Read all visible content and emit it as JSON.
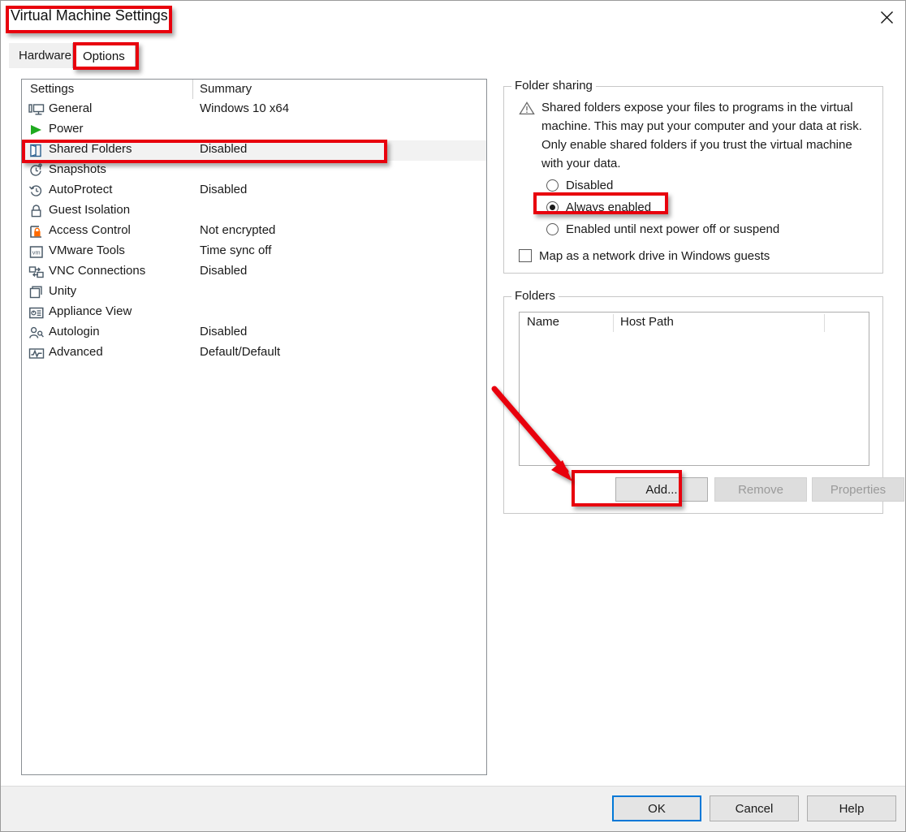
{
  "window": {
    "title": "Virtual Machine Settings",
    "close_icon": "close-icon"
  },
  "tabs": [
    {
      "label": "Hardware",
      "active": false
    },
    {
      "label": "Options",
      "active": true
    }
  ],
  "settings_list": {
    "columns": [
      "Settings",
      "Summary"
    ],
    "rows": [
      {
        "icon": "monitor-icon",
        "name": "General",
        "summary": "Windows 10 x64",
        "selected": false
      },
      {
        "icon": "play-icon",
        "name": "Power",
        "summary": "",
        "selected": false
      },
      {
        "icon": "shared-folder-icon",
        "name": "Shared Folders",
        "summary": "Disabled",
        "selected": true
      },
      {
        "icon": "snapshot-clock-icon",
        "name": "Snapshots",
        "summary": "",
        "selected": false
      },
      {
        "icon": "autoprotect-icon",
        "name": "AutoProtect",
        "summary": "Disabled",
        "selected": false
      },
      {
        "icon": "lock-icon",
        "name": "Guest Isolation",
        "summary": "",
        "selected": false
      },
      {
        "icon": "access-lock-icon",
        "name": "Access Control",
        "summary": "Not encrypted",
        "selected": false
      },
      {
        "icon": "vmware-tools-icon",
        "name": "VMware Tools",
        "summary": "Time sync off",
        "selected": false
      },
      {
        "icon": "vnc-icon",
        "name": "VNC Connections",
        "summary": "Disabled",
        "selected": false
      },
      {
        "icon": "unity-icon",
        "name": "Unity",
        "summary": "",
        "selected": false
      },
      {
        "icon": "appliance-icon",
        "name": "Appliance View",
        "summary": "",
        "selected": false
      },
      {
        "icon": "autologin-icon",
        "name": "Autologin",
        "summary": "Disabled",
        "selected": false
      },
      {
        "icon": "advanced-icon",
        "name": "Advanced",
        "summary": "Default/Default",
        "selected": false
      }
    ]
  },
  "folder_sharing": {
    "legend": "Folder sharing",
    "warning_icon": "warning-triangle-icon",
    "warning_text": "Shared folders expose your files to programs in the virtual machine. This may put your computer and your data at risk. Only enable shared folders if you trust the virtual machine with your data.",
    "options": [
      {
        "label": "Disabled",
        "selected": false
      },
      {
        "label": "Always enabled",
        "selected": true
      },
      {
        "label": "Enabled until next power off or suspend",
        "selected": false
      }
    ],
    "map_drive": {
      "label": "Map as a network drive in Windows guests",
      "checked": false
    }
  },
  "folders": {
    "legend": "Folders",
    "columns": [
      "Name",
      "Host Path",
      ""
    ],
    "rows": [],
    "buttons": [
      {
        "label": "Add...",
        "enabled": true
      },
      {
        "label": "Remove",
        "enabled": false
      },
      {
        "label": "Properties",
        "enabled": false
      }
    ]
  },
  "footer_buttons": [
    {
      "label": "OK",
      "default": true
    },
    {
      "label": "Cancel",
      "default": false
    },
    {
      "label": "Help",
      "default": false
    }
  ],
  "annotations": {
    "color": "#e8000d",
    "highlights": [
      "window-title",
      "tab-options",
      "row-shared-folders",
      "radio-always-enabled",
      "button-add"
    ],
    "arrow": "points from folders list area down-right to the Add button"
  }
}
